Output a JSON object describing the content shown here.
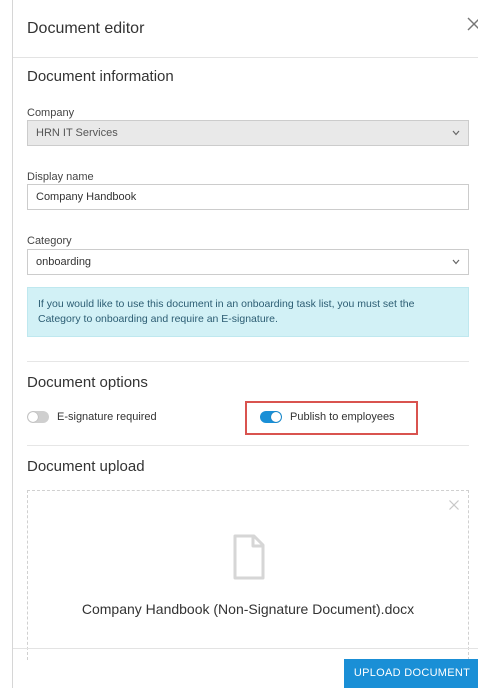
{
  "header": {
    "title": "Document editor",
    "close_icon": "close-icon"
  },
  "document_information": {
    "title": "Document information",
    "company": {
      "label": "Company",
      "value": "HRN IT Services",
      "disabled": true
    },
    "display_name": {
      "label": "Display name",
      "value": "Company Handbook"
    },
    "category": {
      "label": "Category",
      "value": "onboarding"
    },
    "info_message": "If you would like to use this document in an onboarding task list, you must set the Category to onboarding and require an E-signature."
  },
  "document_options": {
    "title": "Document options",
    "e_signature": {
      "label": "E-signature required",
      "enabled": false
    },
    "publish": {
      "label": "Publish to employees",
      "enabled": true
    }
  },
  "document_upload": {
    "title": "Document upload",
    "file_name": "Company Handbook (Non-Signature Document).docx",
    "file_icon": "file-icon"
  },
  "footer": {
    "upload_label": "UPLOAD DOCUMENT"
  },
  "colors": {
    "accent": "#1a8fd6",
    "info_background": "#d2f1f6",
    "highlight": "#d9534f"
  }
}
